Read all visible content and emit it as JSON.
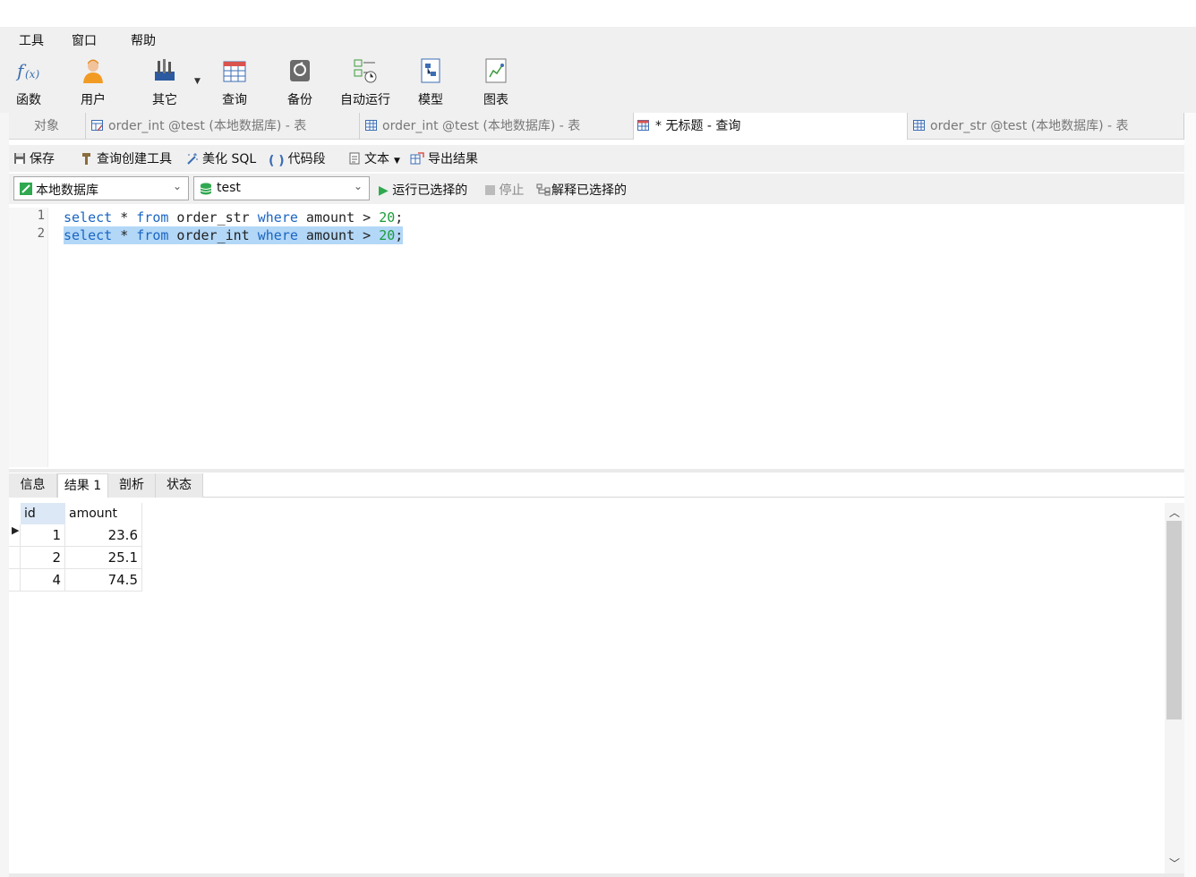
{
  "menu": [
    "工具",
    "窗口",
    "帮助"
  ],
  "ribbon": [
    {
      "label": "函数",
      "icon": "function-icon"
    },
    {
      "label": "用户",
      "icon": "user-icon"
    },
    {
      "label": "其它",
      "icon": "tools-icon"
    },
    {
      "label": "查询",
      "icon": "query-icon"
    },
    {
      "label": "备份",
      "icon": "backup-icon"
    },
    {
      "label": "自动运行",
      "icon": "schedule-icon"
    },
    {
      "label": "模型",
      "icon": "model-icon"
    },
    {
      "label": "图表",
      "icon": "chart-icon"
    }
  ],
  "tabs": [
    {
      "label": "对象"
    },
    {
      "label": "order_int @test (本地数据库) - 表"
    },
    {
      "label": "order_int @test (本地数据库) - 表"
    },
    {
      "label": "* 无标题 - 查询"
    },
    {
      "label": "order_str @test (本地数据库) - 表"
    }
  ],
  "query_toolbar": {
    "save": "保存",
    "builder": "查询创建工具",
    "beautify": "美化 SQL",
    "snippet": "代码段",
    "text": "文本",
    "export": "导出结果"
  },
  "connection": {
    "server": "本地数据库",
    "database": "test",
    "run_selected": "运行已选择的",
    "stop": "停止",
    "explain": "解释已选择的"
  },
  "editor": {
    "line_numbers": [
      "1",
      "2"
    ],
    "line1": {
      "kw1": "select",
      "t1": " * ",
      "kw2": "from",
      "t2": " order_str ",
      "kw3": "where",
      "t3": " amount > ",
      "num": "20",
      "end": ";"
    },
    "line2": {
      "kw1": "select",
      "t1": " * ",
      "kw2": "from",
      "t2": " order_int ",
      "kw3": "where",
      "t3": " amount > ",
      "num": "20",
      "end": ";"
    }
  },
  "result_tabs": [
    "信息",
    "结果 1",
    "剖析",
    "状态"
  ],
  "result": {
    "columns": [
      "id",
      "amount"
    ],
    "rows": [
      {
        "id": "1",
        "amount": "23.6"
      },
      {
        "id": "2",
        "amount": "25.1"
      },
      {
        "id": "4",
        "amount": "74.5"
      }
    ]
  },
  "colors": {
    "accent": "#1a65c2",
    "number": "#1a9c3a",
    "selection": "#b3d7f7"
  }
}
